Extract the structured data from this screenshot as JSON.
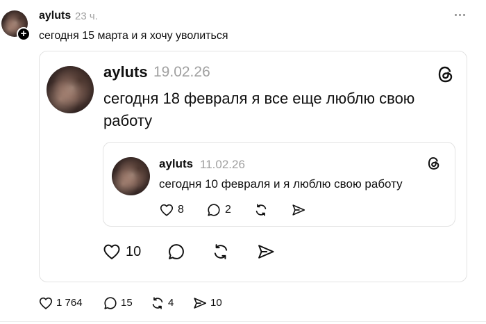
{
  "post": {
    "username": "ayluts",
    "time": "23 ч.",
    "text": "сегодня 15 марта и я хочу уволиться",
    "follow_symbol": "+",
    "actions": {
      "likes": "1 764",
      "replies": "15",
      "reposts": "4",
      "shares": "10"
    }
  },
  "quote": {
    "username": "ayluts",
    "date": "19.02.26",
    "text_line1": "сегодня 18 февраля я все еще люблю свою",
    "text_line2": "работу",
    "actions": {
      "likes": "10"
    }
  },
  "nested_quote": {
    "username": "ayluts",
    "date": "11.02.26",
    "text": "сегодня 10 февраля и я люблю свою работу",
    "actions": {
      "likes": "8",
      "replies": "2"
    }
  },
  "icons": {
    "heart": "heart-icon",
    "reply": "reply-icon",
    "repost": "repost-icon",
    "share": "share-icon",
    "threads": "threads-logo-icon",
    "more": "more-options-icon"
  }
}
